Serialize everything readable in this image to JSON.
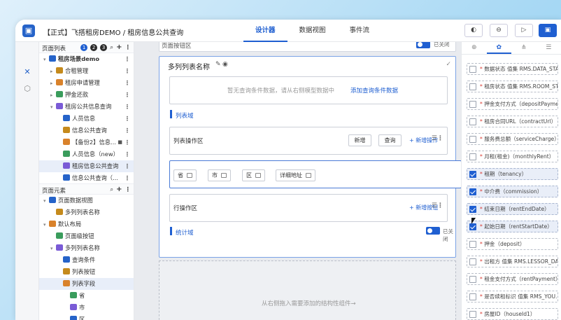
{
  "app": {
    "title": "【正式】飞搭租房DEMO / 租房信息公共查询",
    "tabs": [
      "设计器",
      "数据视图",
      "事件流"
    ],
    "active_tab": 0,
    "toolbar_glyphs": [
      "◐",
      "⊖",
      "▷",
      "▣"
    ],
    "accent": "#1f5fd1"
  },
  "page_list": {
    "title": "页面列表",
    "badges": [
      "1",
      "2",
      "3"
    ],
    "tree": [
      {
        "label": "租房场景demo",
        "depth": 0,
        "bold": true,
        "caret": "▾"
      },
      {
        "label": "合租管理",
        "depth": 1,
        "caret": "▸"
      },
      {
        "label": "租房申请管理",
        "depth": 1,
        "caret": "▸"
      },
      {
        "label": "押金还款",
        "depth": 1,
        "caret": "▸"
      },
      {
        "label": "租房公共信息查询",
        "depth": 1,
        "caret": "▾"
      },
      {
        "label": "人员信息",
        "depth": 2,
        "caret": ""
      },
      {
        "label": "信息公共查询",
        "depth": 2,
        "caret": ""
      },
      {
        "label": "【备份2】信息...",
        "depth": 2,
        "caret": "",
        "lock": true
      },
      {
        "label": "人员信息（new）",
        "depth": 2,
        "caret": ""
      },
      {
        "label": "租房信息公共查询",
        "depth": 2,
        "caret": "",
        "selected": true
      },
      {
        "label": "信息公共查询（...",
        "depth": 2,
        "caret": ""
      }
    ]
  },
  "page_elements": {
    "title": "页面元素",
    "tree": [
      {
        "label": "页面数据视图",
        "depth": 0,
        "caret": "▾"
      },
      {
        "label": "多列列表名称",
        "depth": 1,
        "caret": ""
      },
      {
        "label": "默认布局",
        "depth": 0,
        "caret": "▾"
      },
      {
        "label": "页面级按钮",
        "depth": 1,
        "caret": ""
      },
      {
        "label": "多列列表名称",
        "depth": 1,
        "caret": "▾"
      },
      {
        "label": "查询条件",
        "depth": 2,
        "caret": ""
      },
      {
        "label": "列表按钮",
        "depth": 2,
        "caret": ""
      },
      {
        "label": "列表字段",
        "depth": 2,
        "caret": "",
        "selected": true
      },
      {
        "label": "省",
        "depth": 3,
        "caret": ""
      },
      {
        "label": "市",
        "depth": 3,
        "caret": ""
      },
      {
        "label": "区",
        "depth": 3,
        "caret": ""
      }
    ]
  },
  "canvas": {
    "top_strip": "页面按钮区",
    "top_toggle_label": "已关闭",
    "list_title": "多列列表名称",
    "empty_query": "暂无查询条件数据，请从右侧模型数据中",
    "add_query_link": "添加查询条件数据",
    "list_domain": "列表域",
    "list_ops_area": "列表操作区",
    "btn_add": "新增",
    "btn_query": "查询",
    "add_op": "+ 新增操作",
    "fields": [
      "省",
      "市",
      "区",
      "详细地址"
    ],
    "row_ops_area": "行操作区",
    "add_btn": "+ 新增按钮",
    "stats_domain": "统计域",
    "stats_toggle_label": "已关闭",
    "drop_hint": "从右侧拖入需要添加的结构性组件→"
  },
  "right_panel": {
    "tab_glyphs": [
      "⊕",
      "✿",
      "⋔",
      "☰"
    ],
    "active_tab": 1,
    "fields": [
      {
        "label": "数据状态 值集 RMS.DATA_STA...",
        "checked": false
      },
      {
        "label": "租房状态 值集 RMS.ROOM_ST...",
        "checked": false
      },
      {
        "label": "押金支付方式（depositPayme...",
        "checked": false
      },
      {
        "label": "租房合同URL（contractUrl）",
        "checked": false
      },
      {
        "label": "服务费总额（serviceCharge）",
        "checked": false
      },
      {
        "label": "月租(租金)（monthlyRent）",
        "checked": false
      },
      {
        "label": "租期（tenancy）",
        "checked": true
      },
      {
        "label": "中介费（commission）",
        "checked": true
      },
      {
        "label": "结束日期（rentEndDate）",
        "checked": true
      },
      {
        "label": "起始日期（rentStartDate）",
        "checked": true
      },
      {
        "label": "押金（deposit）",
        "checked": false
      },
      {
        "label": "出租方 值集 RMS.LESSOR_DA...",
        "checked": false
      },
      {
        "label": "租金支付方式（rentPayment）",
        "checked": false
      },
      {
        "label": "是否续租标识 值集 RMS_YOU...",
        "checked": false
      },
      {
        "label": "房屋ID（houseId1）",
        "checked": false
      }
    ]
  }
}
